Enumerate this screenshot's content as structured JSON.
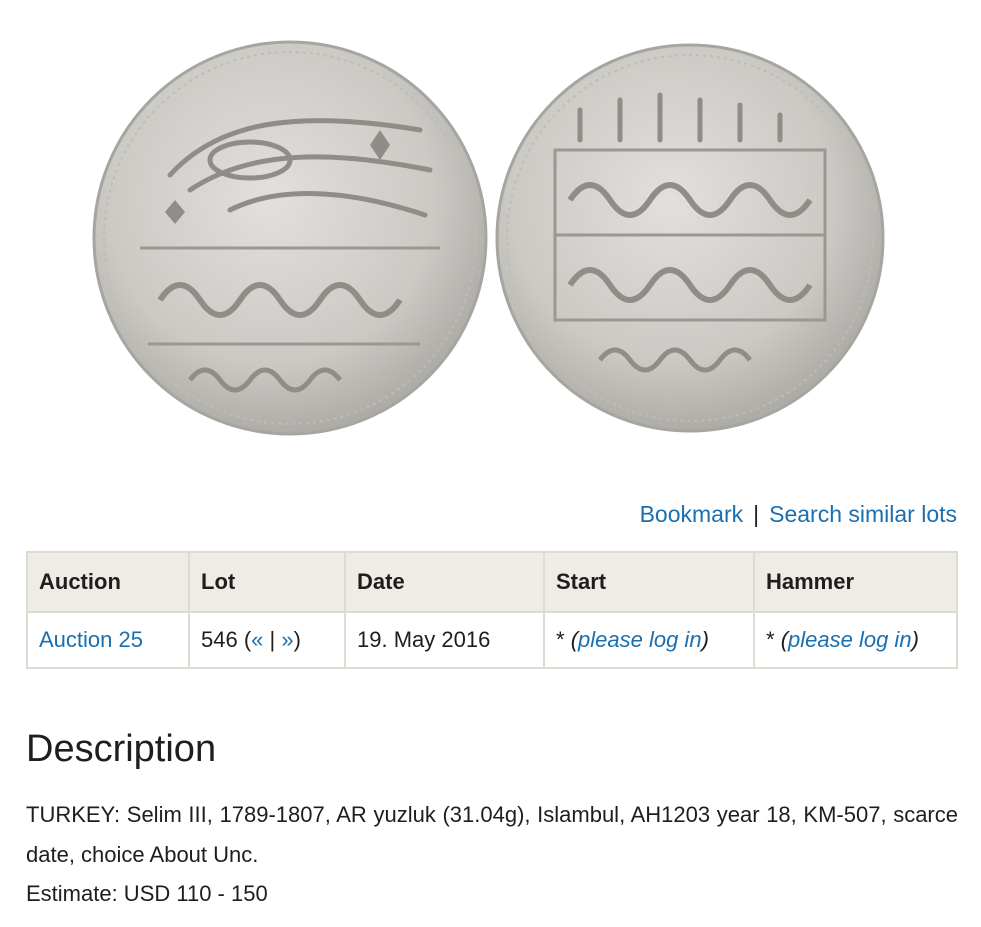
{
  "links": {
    "bookmark": "Bookmark",
    "separator": "|",
    "search_similar": "Search similar lots"
  },
  "table": {
    "headers": [
      "Auction",
      "Lot",
      "Date",
      "Start",
      "Hammer"
    ],
    "row": {
      "auction": "Auction 25",
      "lot_number": "546",
      "lot_prev": "«",
      "lot_sep": "|",
      "lot_next": "»",
      "date": "19. May 2016",
      "start_asterisk": "*",
      "start_login": "please log in",
      "hammer_asterisk": "*",
      "hammer_login": "please log in"
    }
  },
  "description": {
    "title": "Description",
    "text": "TURKEY: Selim III, 1789-1807, AR yuzluk (31.04g), Islambul, AH1203 year 18, KM-507, scarce date, choice About Unc.",
    "estimate": "Estimate: USD 110 - 150"
  },
  "colors": {
    "link": "#1a6fb0",
    "table_header_bg": "#efece6",
    "table_border": "#dedbd2",
    "coin_silver": "#cfcdc8"
  }
}
